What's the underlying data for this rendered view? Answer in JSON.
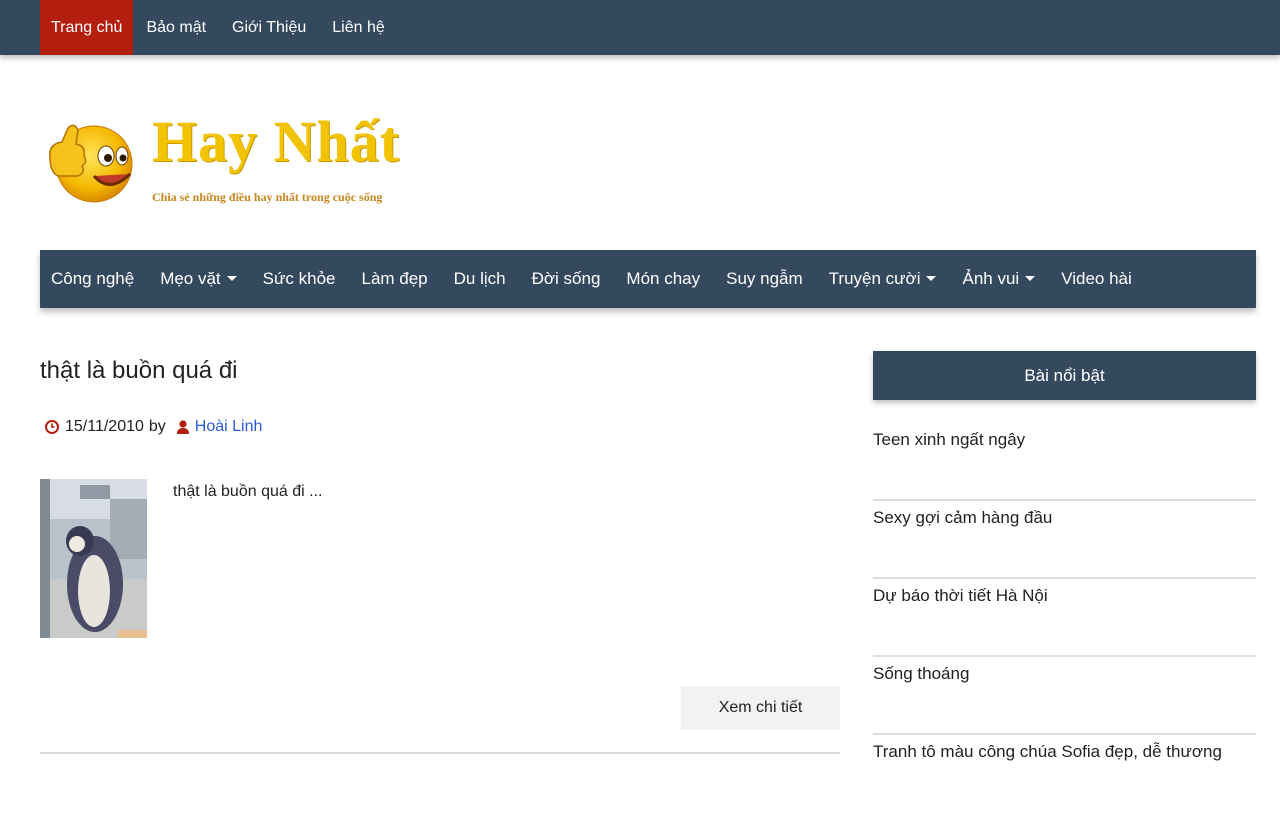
{
  "topnav": {
    "items": [
      {
        "label": "Trang chủ",
        "active": true
      },
      {
        "label": "Bảo mật"
      },
      {
        "label": "Giới Thiệu"
      },
      {
        "label": "Liên hệ"
      }
    ]
  },
  "logo": {
    "title": "Hay Nhất",
    "tagline": "Chia sẻ những điều hay nhất trong cuộc sống"
  },
  "mainnav": {
    "items": [
      {
        "label": "Công nghệ"
      },
      {
        "label": "Mẹo vặt",
        "dropdown": true
      },
      {
        "label": "Sức khỏe"
      },
      {
        "label": "Làm đẹp"
      },
      {
        "label": "Du lịch"
      },
      {
        "label": "Đời sống"
      },
      {
        "label": "Món chay"
      },
      {
        "label": "Suy ngẫm"
      },
      {
        "label": "Truyện cười",
        "dropdown": true
      },
      {
        "label": "Ảnh vui",
        "dropdown": true
      },
      {
        "label": "Video hài"
      }
    ]
  },
  "post": {
    "title": "thật là buồn quá đi",
    "date": "15/11/2010",
    "by": "by",
    "author": "Hoài Linh",
    "excerpt": "thật là buồn quá đi ...",
    "read_more": "Xem chi tiết"
  },
  "sidebar": {
    "title": "Bài nổi bật",
    "items": [
      "Teen xinh ngất ngây",
      "Sexy gợi cảm hàng đầu",
      "Dự báo thời tiết Hà Nội",
      "Sống thoáng",
      "Tranh tô màu công chúa Sofia đẹp, dễ thương"
    ]
  },
  "colors": {
    "nav_bg": "#34495e",
    "active_tab": "#b31e0f",
    "logo_yellow": "#f2c300",
    "author_link": "#2b5cd6",
    "meta_icon_red": "#b31e0f"
  }
}
